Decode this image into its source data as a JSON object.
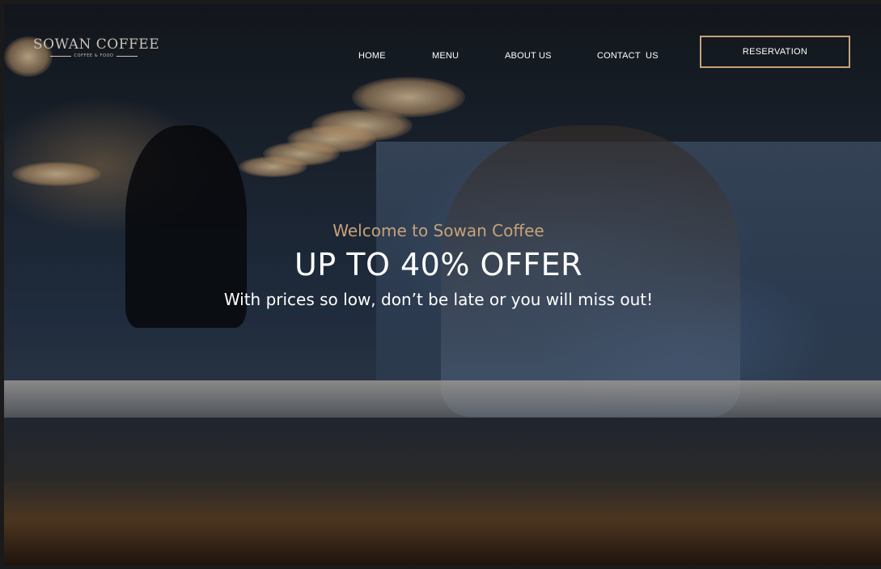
{
  "brand": {
    "name": "SOWAN COFFEE",
    "tagline": "COFFEE & FOOD"
  },
  "nav": {
    "items": [
      {
        "label": "HOME"
      },
      {
        "label": "MENU"
      },
      {
        "label": "ABOUT US"
      },
      {
        "label": "CONTACT  US"
      }
    ],
    "cta_label": "RESERVATION"
  },
  "hero": {
    "welcome": "Welcome to Sowan Coffee",
    "headline": "UP TO 40% OFFER",
    "subheadline": "With prices so low, don’t be late or you will miss out!"
  },
  "colors": {
    "accent": "#c6a27b",
    "text": "#ffffff",
    "logo": "#c9c2b8"
  }
}
